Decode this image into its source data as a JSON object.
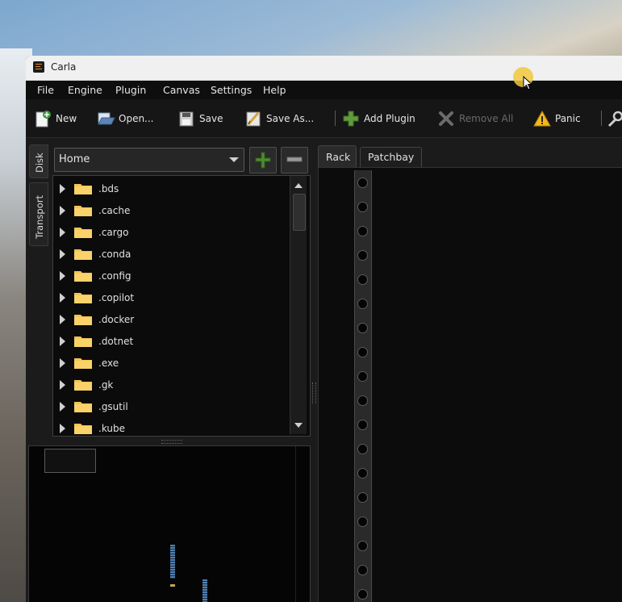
{
  "window": {
    "title": "Carla"
  },
  "menu": [
    "File",
    "Engine",
    "Plugin",
    "Canvas",
    "Settings",
    "Help"
  ],
  "toolbar": {
    "new": "New",
    "open": "Open...",
    "save": "Save",
    "save_as": "Save As...",
    "add_plugin": "Add Plugin",
    "remove_all": "Remove All",
    "panic": "Panic"
  },
  "side_tabs": {
    "disk": "Disk",
    "transport": "Transport"
  },
  "disk": {
    "location": "Home",
    "folders": [
      ".bds",
      ".cache",
      ".cargo",
      ".conda",
      ".config",
      ".copilot",
      ".docker",
      ".dotnet",
      ".exe",
      ".gk",
      ".gsutil",
      ".kube"
    ]
  },
  "tabs": {
    "rack": "Rack",
    "patchbay": "Patchbay"
  },
  "colors": {
    "accent": "#e08a2d",
    "folder": "#f5c453",
    "panic": "#f2b81c",
    "add": "#62a53c"
  }
}
